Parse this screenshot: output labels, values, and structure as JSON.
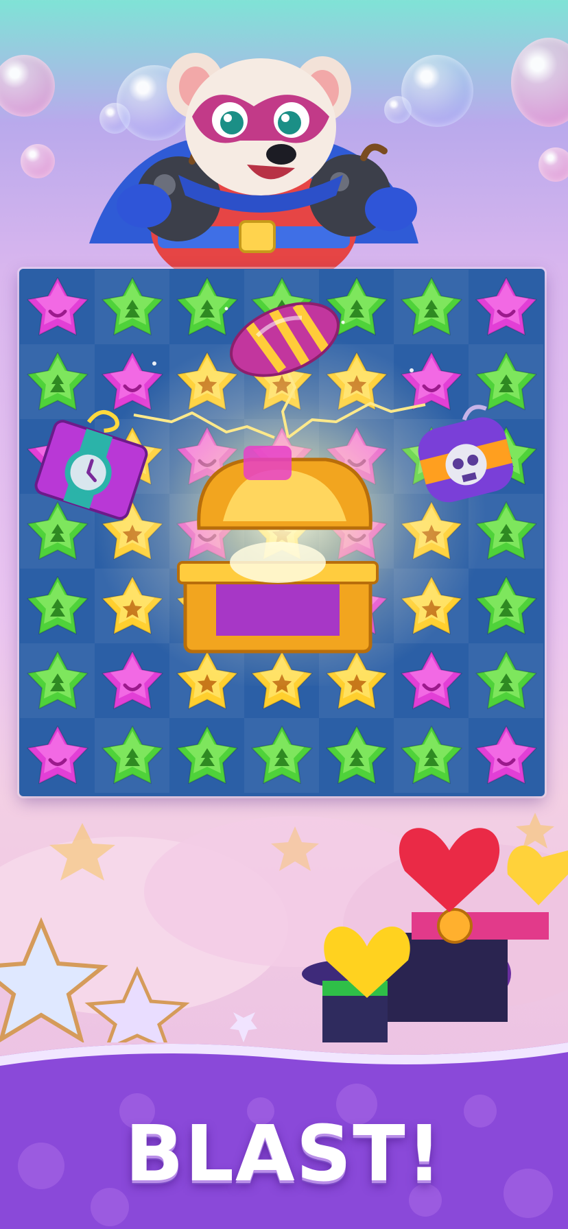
{
  "title_text": "BLAST!",
  "board": {
    "rows": 7,
    "cols": 7,
    "gems": [
      [
        "pink",
        "green",
        "green",
        "green",
        "green",
        "green",
        "pink"
      ],
      [
        "green",
        "pink",
        "yellow",
        "yellow",
        "yellow",
        "pink",
        "green"
      ],
      [
        "pink",
        "yellow",
        "pink",
        "pink",
        "pink",
        "green",
        "green"
      ],
      [
        "green",
        "yellow",
        "pink",
        "yellow",
        "pink",
        "yellow",
        "green"
      ],
      [
        "green",
        "yellow",
        "yellow",
        "yellow",
        "pink",
        "yellow",
        "green"
      ],
      [
        "green",
        "pink",
        "yellow",
        "yellow",
        "yellow",
        "pink",
        "green"
      ],
      [
        "pink",
        "green",
        "green",
        "green",
        "green",
        "green",
        "pink"
      ]
    ]
  },
  "boosters": [
    "rocket-booster",
    "clock-booster",
    "skull-bomb-booster",
    "treasure-chest"
  ],
  "colors": {
    "board": "#2b5fa6",
    "gem_pink": "#e23fd6",
    "gem_green": "#4fd23a",
    "gem_yellow": "#ffcf2e",
    "banner": "#8a49d9"
  }
}
